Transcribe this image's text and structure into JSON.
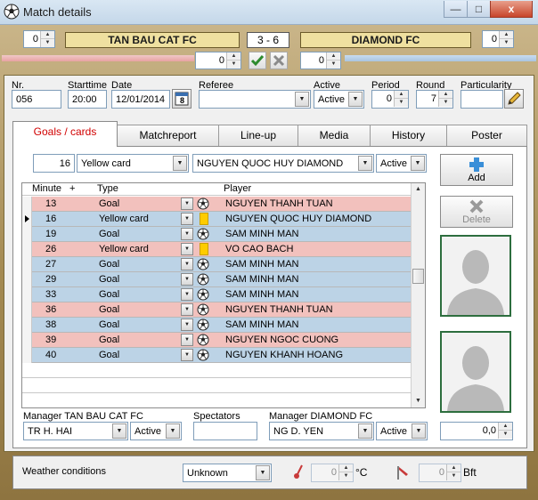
{
  "window": {
    "title": "Match details",
    "min_glyph": "—",
    "max_glyph": "□",
    "close_glyph": "x"
  },
  "header": {
    "home_team": "TAN BAU CAT FC",
    "away_team": "DIAMOND FC",
    "score": "3  - 6",
    "home_extra": "0",
    "away_extra": "0",
    "home_penalty": "0",
    "away_penalty": "0"
  },
  "info": {
    "nr_label": "Nr.",
    "nr_value": "056",
    "starttime_label": "Starttime",
    "starttime_value": "20:00",
    "date_label": "Date",
    "date_value": "12/01/2014",
    "calendar_day": "8",
    "referee_label": "Referee",
    "referee_value": "",
    "active_label": "Active",
    "active_value": "Active",
    "period_label": "Period",
    "period_value": "0",
    "round_label": "Round",
    "round_value": "7",
    "particularity_label": "Particularity"
  },
  "tabs": [
    {
      "label": "Goals / cards",
      "active": true
    },
    {
      "label": "Matchreport",
      "active": false
    },
    {
      "label": "Line-up",
      "active": false
    },
    {
      "label": "Media",
      "active": false
    },
    {
      "label": "History",
      "active": false
    },
    {
      "label": "Poster",
      "active": false
    }
  ],
  "editor": {
    "minute": "16",
    "type": "Yellow card",
    "player": "NGUYEN QUOC HUY DIAMOND",
    "status": "Active"
  },
  "grid": {
    "headers": {
      "minute": "Minute",
      "plus": "+",
      "type": "Type",
      "player": "Player"
    },
    "rows": [
      {
        "minute": "13",
        "type": "Goal",
        "player": "NGUYEN THANH TUAN",
        "team": "home",
        "current": false
      },
      {
        "minute": "16",
        "type": "Yellow card",
        "player": "NGUYEN QUOC HUY DIAMOND",
        "team": "away",
        "current": true
      },
      {
        "minute": "19",
        "type": "Goal",
        "player": "SAM MINH MAN",
        "team": "away",
        "current": false
      },
      {
        "minute": "26",
        "type": "Yellow card",
        "player": "VO CAO BACH",
        "team": "home",
        "current": false
      },
      {
        "minute": "27",
        "type": "Goal",
        "player": "SAM MINH MAN",
        "team": "away",
        "current": false
      },
      {
        "minute": "29",
        "type": "Goal",
        "player": "SAM MINH MAN",
        "team": "away",
        "current": false
      },
      {
        "minute": "33",
        "type": "Goal",
        "player": "SAM MINH MAN",
        "team": "away",
        "current": false
      },
      {
        "minute": "36",
        "type": "Goal",
        "player": "NGUYEN THANH TUAN",
        "team": "home",
        "current": false
      },
      {
        "minute": "38",
        "type": "Goal",
        "player": "SAM MINH MAN",
        "team": "away",
        "current": false
      },
      {
        "minute": "39",
        "type": "Goal",
        "player": "NGUYEN NGOC CUONG",
        "team": "home",
        "current": false
      },
      {
        "minute": "40",
        "type": "Goal",
        "player": "NGUYEN KHANH HOANG",
        "team": "away",
        "current": false
      }
    ]
  },
  "buttons": {
    "add": "Add",
    "delete": "Delete"
  },
  "managers": {
    "home_label": "Manager TAN BAU CAT FC",
    "home_value": "TR H. HAI",
    "home_status": "Active",
    "spectators_label": "Spectators",
    "spectators_value": "",
    "away_label": "Manager DIAMOND FC",
    "away_value": "NG D. YEN",
    "away_status": "Active",
    "rating_value": "0,0"
  },
  "weather": {
    "label": "Weather conditions",
    "condition": "Unknown",
    "temperature": "0",
    "temperature_unit": "°C",
    "wind": "0",
    "wind_unit": "Bft"
  },
  "colors": {
    "home_row": "#f2c1bd",
    "away_row": "#bcd3e6",
    "active_tab_text": "#d10000",
    "team_box": "#efe0a0"
  }
}
